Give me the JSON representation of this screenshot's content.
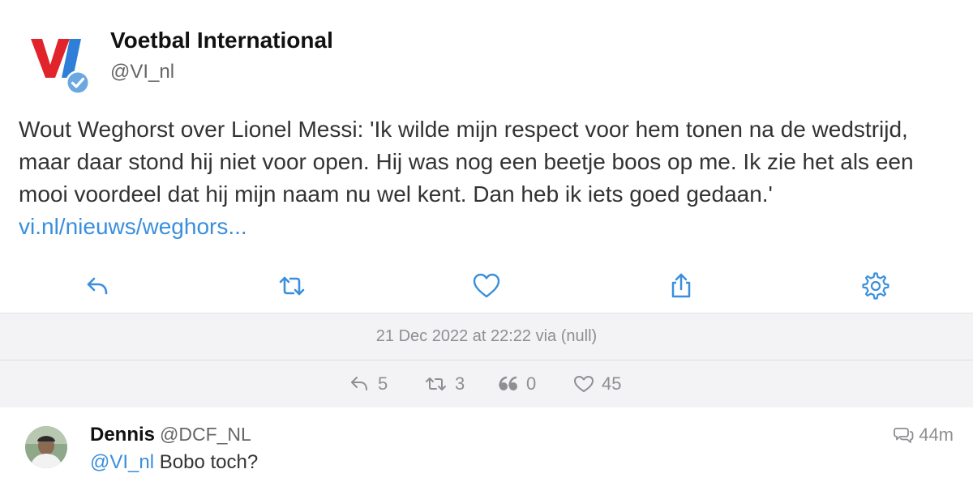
{
  "tweet": {
    "author_name": "Voetbal International",
    "author_handle": "@VI_nl",
    "text": "Wout Weghorst over Lionel Messi: 'Ik wilde mijn respect voor hem tonen na de wedstrijd, maar daar stond hij niet voor open. Hij was nog een beetje boos op me. Ik zie het als een mooi voordeel dat hij mijn naam nu wel kent. Dan heb ik iets goed gedaan.'",
    "link_text": "vi.nl/nieuws/weghors...",
    "logo_icon": "vi-logo-icon",
    "verified_icon": "verified-badge-icon",
    "colors": {
      "link": "#3a8fdc",
      "logo_red": "#e1242c",
      "logo_blue": "#2f7fd8",
      "verified": "#6ba7e0"
    }
  },
  "actions": {
    "reply_icon": "reply-icon",
    "retweet_icon": "retweet-icon",
    "like_icon": "heart-icon",
    "share_icon": "share-icon",
    "settings_icon": "gear-icon"
  },
  "meta": {
    "timestamp": "21 Dec 2022 at 22:22 via (null)",
    "reply_count": "5",
    "retweet_count": "3",
    "quote_count": "0",
    "like_count": "45"
  },
  "reply": {
    "author_name": "Dennis",
    "author_handle": "@DCF_NL",
    "mention": "@VI_nl",
    "text": "Bobo toch?",
    "time": "44m",
    "conversation_icon": "conversation-icon"
  }
}
